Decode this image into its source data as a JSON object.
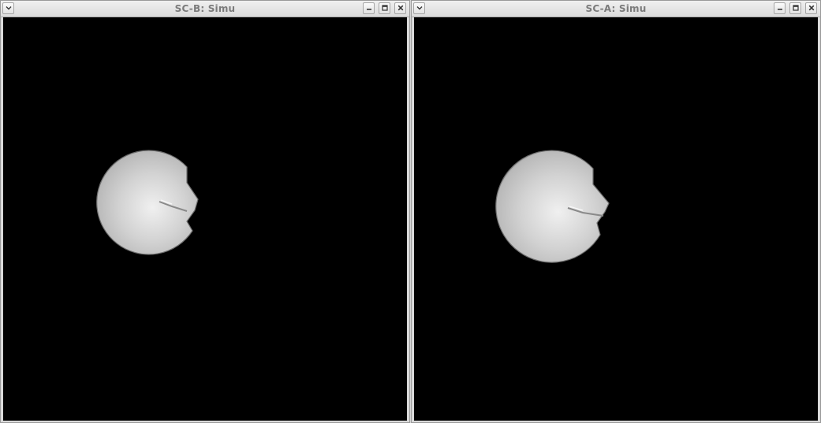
{
  "windows": [
    {
      "id": "b",
      "title": "SC-B: Simu",
      "buttons": {
        "menu_icon": "chevron-down-icon",
        "minimize_icon": "minimize-icon",
        "maximize_icon": "maximize-icon",
        "close_icon": "close-icon"
      },
      "colors": {
        "background": "#000000",
        "shape": "#c8c8c8"
      }
    },
    {
      "id": "a",
      "title": "SC-A: Simu",
      "buttons": {
        "menu_icon": "chevron-down-icon",
        "minimize_icon": "minimize-icon",
        "maximize_icon": "maximize-icon",
        "close_icon": "close-icon"
      },
      "colors": {
        "background": "#000000",
        "shape": "#c8c8c8"
      }
    }
  ]
}
